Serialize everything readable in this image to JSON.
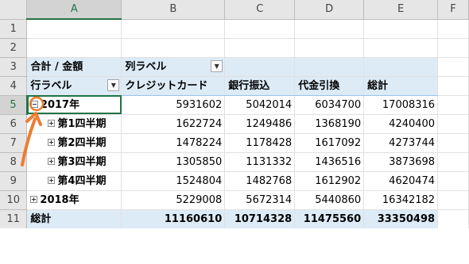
{
  "columns": [
    "A",
    "B",
    "C",
    "D",
    "E",
    "F"
  ],
  "rows": [
    "1",
    "2",
    "3",
    "4",
    "5",
    "6",
    "7",
    "8",
    "9",
    "10",
    "11"
  ],
  "pivot": {
    "row3": {
      "label": "合計 / 金額",
      "col_label": "列ラベル"
    },
    "row4": {
      "row_label": "行ラベル",
      "headers": [
        "クレジットカード",
        "銀行振込",
        "代金引換",
        "総計"
      ]
    },
    "data": [
      {
        "label": "2017年",
        "values": [
          "5931602",
          "5042014",
          "6034700",
          "17008316"
        ]
      },
      {
        "label": "第1四半期",
        "values": [
          "1622724",
          "1249486",
          "1368190",
          "4240400"
        ]
      },
      {
        "label": "第2四半期",
        "values": [
          "1478224",
          "1178428",
          "1617092",
          "4273744"
        ]
      },
      {
        "label": "第3四半期",
        "values": [
          "1305850",
          "1131332",
          "1436516",
          "3873698"
        ]
      },
      {
        "label": "第4四半期",
        "values": [
          "1524804",
          "1482768",
          "1612902",
          "4620474"
        ]
      },
      {
        "label": "2018年",
        "values": [
          "5229008",
          "5672314",
          "5440860",
          "16342182"
        ]
      },
      {
        "label": "総計",
        "values": [
          "11160610",
          "10714328",
          "11475560",
          "33350498"
        ]
      }
    ]
  },
  "icons": {
    "filter_dropdown": "chevron-down-icon",
    "collapse_button": "minus-box-icon",
    "expand_button": "plus-box-icon"
  },
  "colors": {
    "pivot_fill": "#ddebf7",
    "selection": "#217346",
    "annotation_arrow": "#ed7d31"
  }
}
